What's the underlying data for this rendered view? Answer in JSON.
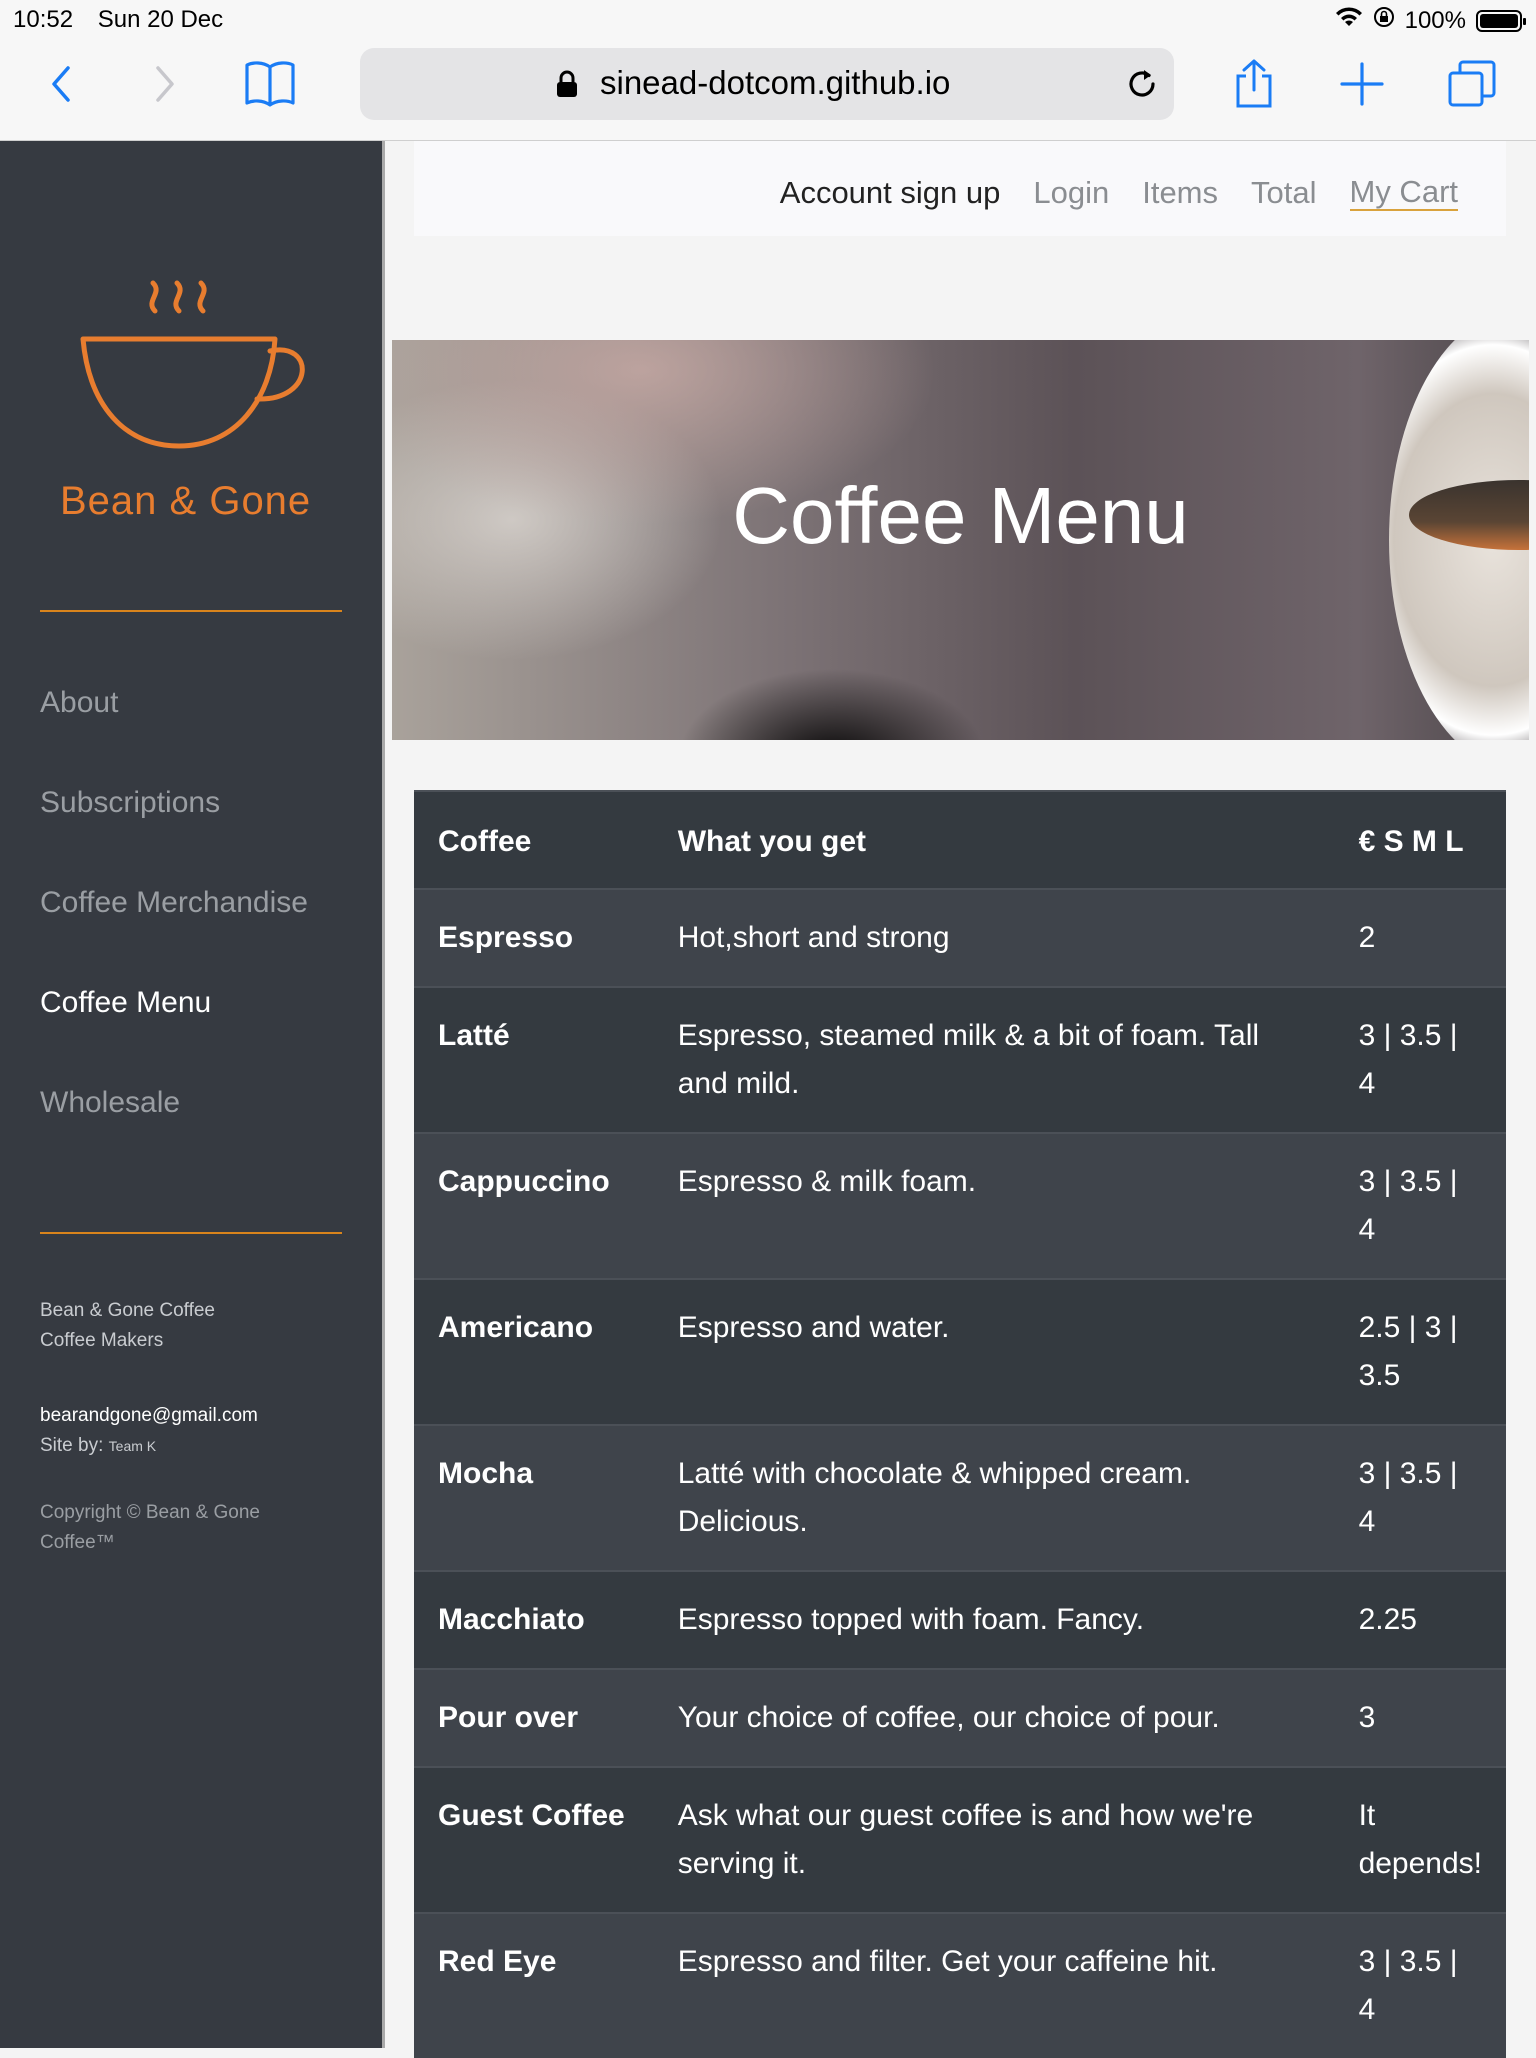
{
  "status_bar": {
    "time": "10:52",
    "date": "Sun 20 Dec",
    "battery": "100%"
  },
  "browser": {
    "url": "sinead-dotcom.github.io"
  },
  "sidebar": {
    "brand": "Bean & Gone",
    "nav": [
      {
        "label": "About"
      },
      {
        "label": "Subscriptions"
      },
      {
        "label": "Coffee Merchandise"
      },
      {
        "label": "Coffee Menu",
        "active": true
      },
      {
        "label": "Wholesale"
      }
    ],
    "footer": {
      "company_line1": "Bean & Gone Coffee",
      "company_line2": "Coffee Makers",
      "email": "bearandgone@gmail.com",
      "site_by_label": "Site by:",
      "site_by_value": "Team K",
      "copyright_line1": "Copyright © Bean & Gone",
      "copyright_line2": "Coffee™"
    }
  },
  "topnav": {
    "links": [
      "Account sign up",
      "Login",
      "Items",
      "Total",
      "My Cart"
    ]
  },
  "hero": {
    "title": "Coffee Menu"
  },
  "table": {
    "headers": [
      "Coffee",
      "What you get",
      "€ S M L"
    ],
    "rows": [
      {
        "name": "Espresso",
        "desc": "Hot,short and strong",
        "price": "2"
      },
      {
        "name": "Latté",
        "desc": "Espresso, steamed milk & a bit of foam. Tall and mild.",
        "price": "3 | 3.5 | 4"
      },
      {
        "name": "Cappuccino",
        "desc": "Espresso & milk foam.",
        "price": "3 | 3.5 | 4"
      },
      {
        "name": "Americano",
        "desc": "Espresso and water.",
        "price": "2.5 | 3 | 3.5"
      },
      {
        "name": "Mocha",
        "desc": "Latté with chocolate & whipped cream. Delicious.",
        "price": "3 | 3.5 | 4"
      },
      {
        "name": "Macchiato",
        "desc": "Espresso topped with foam. Fancy.",
        "price": "2.25"
      },
      {
        "name": "Pour over",
        "desc": "Your choice of coffee, our choice of pour.",
        "price": "3"
      },
      {
        "name": "Guest Coffee",
        "desc": "Ask what our guest coffee is and how we're serving it.",
        "price": "It depends!"
      },
      {
        "name": "Red Eye",
        "desc": "Espresso and filter. Get your caffeine hit.",
        "price": "3 | 3.5 | 4"
      }
    ]
  },
  "colors": {
    "accent": "#e87d2f",
    "sidebar_bg": "#363a41",
    "ios_blue": "#1a7cf5"
  }
}
